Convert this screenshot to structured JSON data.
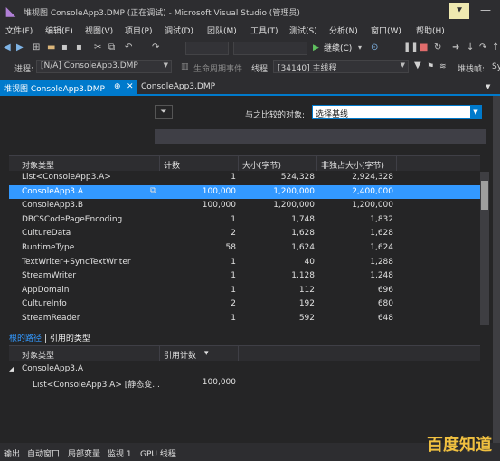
{
  "window": {
    "title": "堆视图 ConsoleApp3.DMP (正在调试) - Microsoft Visual Studio (管理员)",
    "minimize_glyph": "—",
    "filter_glyph": "⯆"
  },
  "menu": [
    "文件(F)",
    "编辑(E)",
    "视图(V)",
    "项目(P)",
    "调试(D)",
    "团队(M)",
    "工具(T)",
    "测试(S)",
    "分析(N)",
    "窗口(W)",
    "帮助(H)"
  ],
  "toolbar": {
    "continue_label": "继续(C)",
    "continue_arrow": "▾"
  },
  "debug_location": {
    "process_label": "进程:",
    "process_value": "[N/A] ConsoleApp3.DMP",
    "lifecycle_label": "生命周期事件",
    "thread_label": "线程:",
    "thread_value": "[34140] 主线程",
    "stackframe_label": "堆栈帧:",
    "stackframe_value": "Sy"
  },
  "tabs": {
    "active_label": "堆视图 ConsoleApp3.DMP",
    "active_pin": "⊕",
    "active_close": "✕",
    "inactive_label": "ConsoleApp3.DMP"
  },
  "compare": {
    "label": "与之比较的对象:",
    "value": "选择基线"
  },
  "object_table": {
    "headers": [
      "对象类型",
      "计数",
      "大小(字节)",
      "非独占大小(字节)"
    ],
    "rows": [
      {
        "type": "List<ConsoleApp3.A>",
        "count": "1",
        "size": "524,328",
        "inclusive": "2,924,328",
        "selected": false
      },
      {
        "type": "ConsoleApp3.A",
        "count": "100,000",
        "size": "1,200,000",
        "inclusive": "2,400,000",
        "selected": true
      },
      {
        "type": "ConsoleApp3.B",
        "count": "100,000",
        "size": "1,200,000",
        "inclusive": "1,200,000",
        "selected": false
      },
      {
        "type": "DBCSCodePageEncoding",
        "count": "1",
        "size": "1,748",
        "inclusive": "1,832",
        "selected": false
      },
      {
        "type": "CultureData",
        "count": "2",
        "size": "1,628",
        "inclusive": "1,628",
        "selected": false
      },
      {
        "type": "RuntimeType",
        "count": "58",
        "size": "1,624",
        "inclusive": "1,624",
        "selected": false
      },
      {
        "type": "TextWriter+SyncTextWriter",
        "count": "1",
        "size": "40",
        "inclusive": "1,288",
        "selected": false
      },
      {
        "type": "StreamWriter",
        "count": "1",
        "size": "1,128",
        "inclusive": "1,248",
        "selected": false
      },
      {
        "type": "AppDomain",
        "count": "1",
        "size": "112",
        "inclusive": "696",
        "selected": false
      },
      {
        "type": "CultureInfo",
        "count": "2",
        "size": "192",
        "inclusive": "680",
        "selected": false
      },
      {
        "type": "StreamReader",
        "count": "1",
        "size": "592",
        "inclusive": "648",
        "selected": false
      }
    ]
  },
  "paths": {
    "tab_root": "根的路径",
    "separator": "|",
    "tab_ref": "引用的类型",
    "headers": [
      "对象类型",
      "引用计数"
    ],
    "sort_glyph": "▾",
    "tree": [
      {
        "label": "ConsoleApp3.A",
        "expander": "◢",
        "count": ""
      },
      {
        "label": "List<ConsoleApp3.A> [静态变...",
        "expander": "",
        "count": "100,000"
      }
    ]
  },
  "bottom_tabs": [
    "输出",
    "自动窗口",
    "局部变量",
    "监视 1",
    "GPU 线程"
  ],
  "watermark": "百度知道",
  "colors": {
    "accent": "#007acc",
    "selection": "#3399ff",
    "background": "#252526",
    "link": "#3399ff"
  }
}
